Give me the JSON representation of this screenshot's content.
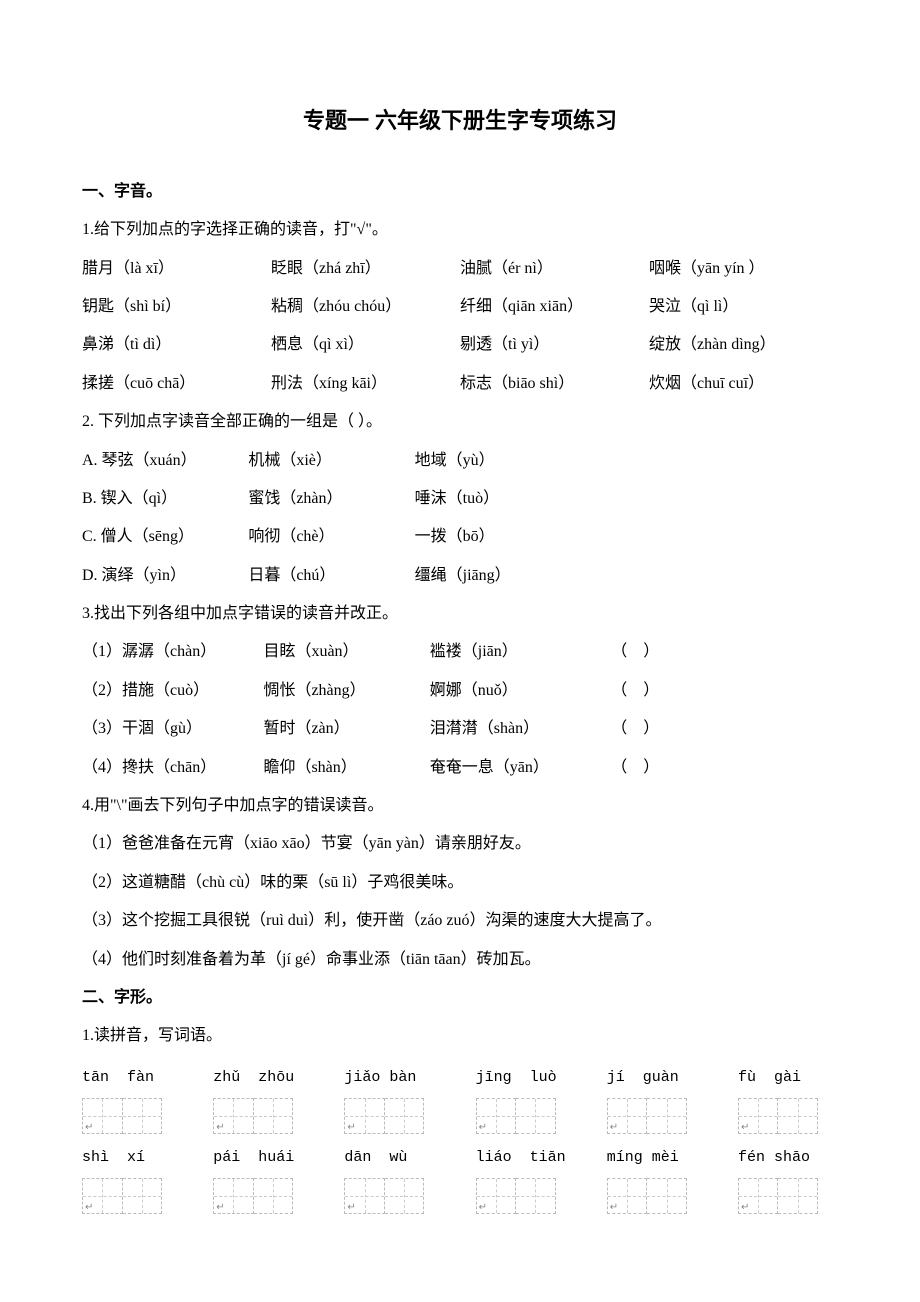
{
  "title": "专题一 六年级下册生字专项练习",
  "sec1": {
    "heading": "一、字音。",
    "q1": {
      "prompt": "1.给下列加点的字选择正确的读音，打\"√\"。",
      "rows": [
        [
          "腊月（là xī）",
          "眨眼（zhá zhī）",
          "油腻（ér nì）",
          "咽喉（yān yín ）"
        ],
        [
          "钥匙（shì bí）",
          "粘稠（zhóu chóu）",
          "纤细（qiān xiān）",
          "哭泣（qì lì）"
        ],
        [
          "鼻涕（tì dì）",
          "栖息（qì xì）",
          "剔透（tì yì）",
          "绽放（zhàn dìng）"
        ],
        [
          "揉搓（cuō chā）",
          "刑法（xíng kāi）",
          "标志（biāo  shì）",
          "炊烟（chuī cuī）"
        ]
      ]
    },
    "q2": {
      "prompt": "2. 下列加点字读音全部正确的一组是（   ）。",
      "opts": [
        [
          "A. 琴弦（xuán）",
          "机械（xiè）",
          "地域（yù）"
        ],
        [
          "B. 锲入（qì）",
          "蜜饯（zhàn）",
          "唾沫（tuò）"
        ],
        [
          "C. 僧人（sēng）",
          "响彻（chè）",
          "一拨（bō）"
        ],
        [
          "D. 演绎（yìn）",
          "日暮（chú）",
          "缰绳（jiāng）"
        ]
      ]
    },
    "q3": {
      "prompt": "3.找出下列各组中加点字错误的读音并改正。",
      "rows": [
        [
          "（1）潺潺（chàn）",
          "目眩（xuàn）",
          "褴褛（jiān）"
        ],
        [
          "（2）措施（cuò）",
          "惆怅（zhàng）",
          "婀娜（nuǒ）"
        ],
        [
          "（3）干涸（gù）",
          "暂时（zàn）",
          "泪潸潸（shàn）"
        ],
        [
          "（4）搀扶（chān）",
          "瞻仰（shàn）",
          "奄奄一息（yān）"
        ]
      ],
      "blank": "（          ）"
    },
    "q4": {
      "prompt": "4.用\"\\\"画去下列句子中加点字的错误读音。",
      "lines": [
        "（1）爸爸准备在元宵（xiāo xāo）节宴（yān yàn）请亲朋好友。",
        "（2）这道糖醋（chù cù）味的栗（sū lì）子鸡很美味。",
        "（3）这个挖掘工具很锐（ruì duì）利，使开凿（záo zuó）沟渠的速度大大提高了。",
        "（4）他们时刻准备着为革（jí gé）命事业添（tiān tāan）砖加瓦。"
      ]
    }
  },
  "sec2": {
    "heading": "二、字形。",
    "q1": {
      "prompt": "1.读拼音，写词语。",
      "row1": [
        "tān  fàn",
        "zhǔ  zhōu",
        "jiǎo bàn",
        "jīng  luò",
        "jí  guàn",
        "fù  gài"
      ],
      "row2": [
        "shì  xí",
        "pái  huái",
        "dān  wù",
        "liáo  tiān",
        "míng mèi",
        "fén shāo"
      ]
    }
  }
}
